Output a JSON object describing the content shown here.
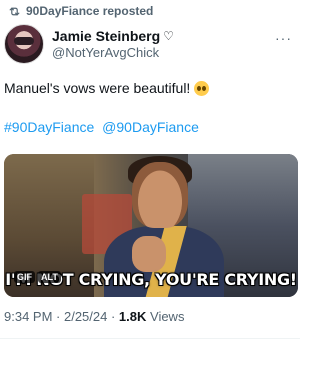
{
  "repost": {
    "label": "90DayFiance reposted",
    "icon": "repost-icon"
  },
  "author": {
    "display_name": "Jamie Steinberg",
    "heart": "♡",
    "handle": "@NotYerAvgChick"
  },
  "menu": {
    "icon": "more-icon",
    "glyph": "···"
  },
  "tweet": {
    "text": "Manuel's vows were beautiful!",
    "emoji": "pleading-face-emoji",
    "hashtags": [
      "#90DayFiance",
      "@90DayFiance"
    ]
  },
  "media": {
    "caption": "I'M NOT CRYING, YOU'RE CRYING!",
    "badges": [
      "GIF",
      "ALT"
    ]
  },
  "meta": {
    "time": "9:34 PM",
    "sep1": " · ",
    "date": "2/25/24",
    "sep2": " · ",
    "views_count": "1.8K",
    "views_label": " Views"
  },
  "colors": {
    "link": "#1d9bf0",
    "secondary": "#536471",
    "text": "#0f1419"
  }
}
